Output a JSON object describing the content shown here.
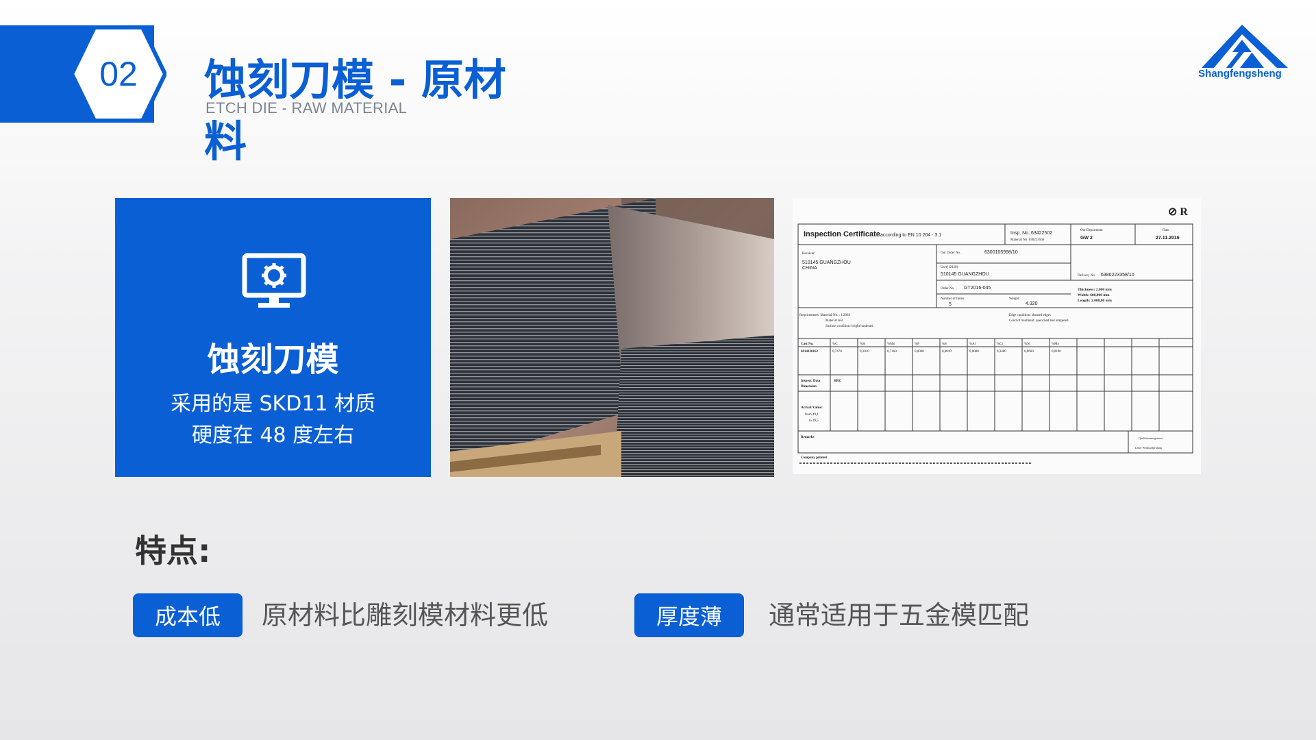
{
  "header": {
    "section_number": "02",
    "title": "蚀刻刀模 - 原材料",
    "subtitle": "ETCH DIE - RAW MATERIAL"
  },
  "logo": {
    "text": "Shangfengsheng",
    "icon": "mountain-logo-icon"
  },
  "card": {
    "icon": "monitor-gear-icon",
    "title": "蚀刻刀模",
    "line1": "采用的是 SKD11 材质",
    "line2": "硬度在 48 度左右"
  },
  "certificate": {
    "title": "Inspection Certificate",
    "according": "according to  EN 10 204 - 3.1",
    "insp_no": "Insp. No. 63422502",
    "material_no": "Material No. 630233568",
    "dept_label": "Our Department",
    "dept": "GW 2",
    "date_label": "Date",
    "date": "27.11.2016",
    "brand": "⊘ R",
    "receiver_label": "Receiver:",
    "receiver1": "510145 GUANGZHOU",
    "receiver2": "CHINA",
    "our_order_label": "Our Order No.",
    "our_order": "6300105998/10",
    "user_label": "User(12128)",
    "user": "510145 GUANGZHOU",
    "order_label": "Order No.",
    "order": "GT2016-045",
    "delivery_label": "Delivery No.",
    "delivery": "6380223358/10",
    "items_label": "Number of Items:",
    "items": "5",
    "weight_label": "Weight:",
    "weight": "4.320",
    "thickness": "Thickness:  2.000 mm",
    "width": "Width:  600,000 mm",
    "length": "Length:  2.000,00 mm",
    "req1": "Requirements:  Material-No.  :   1.2003",
    "req2": "Material text",
    "req3": "Surface condition:   bright hardened",
    "edge": "Edge condition:   sheared edges",
    "cond": "Cond.of treatment:   quenched and tempered",
    "cast_label": "Cast No.",
    "cast": "6014120162",
    "elements": [
      "%C",
      "%Si",
      "%Mn",
      "%P",
      "%S",
      "%Al",
      "%Cr",
      "%Ni",
      "%Mo"
    ],
    "element_values": [
      "0,7470",
      "0,3010",
      "0,7160",
      "0,0060",
      "0,0010",
      "0,0080",
      "0,3480",
      "0,0660",
      "0,0190"
    ],
    "inspect_label": "Inspect. Data",
    "hrc": "HRC",
    "dimension": "Dimension",
    "actual_label": "Actual Value:",
    "from": "from   49,1",
    "to": "to   49,5",
    "remarks": "Remarks",
    "qm1": "Qualitätsmanagement",
    "qm2": "Leiter Werkstoffprüfung",
    "footer": "Company printed"
  },
  "features": {
    "heading": "特点:",
    "items": [
      {
        "tag": "成本低",
        "text": "原材料比雕刻模材料更低"
      },
      {
        "tag": "厚度薄",
        "text": "通常适用于五金模匹配"
      }
    ]
  }
}
